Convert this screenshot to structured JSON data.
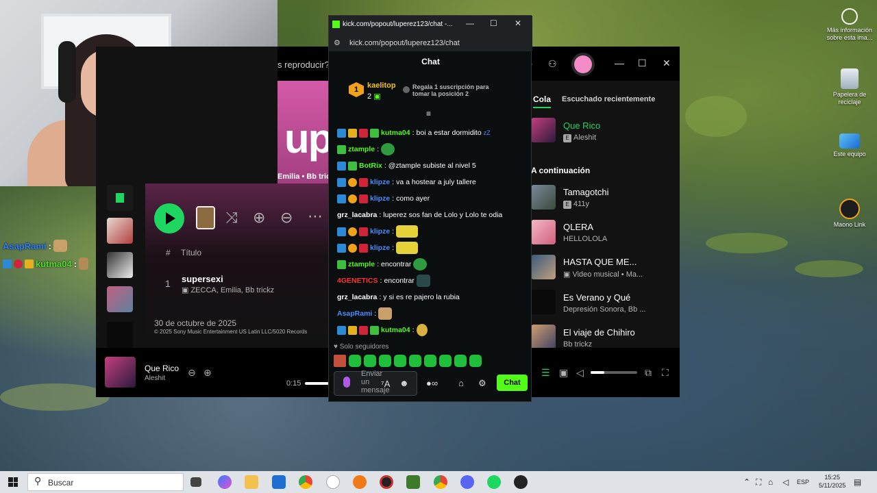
{
  "webcam_overlay_chat": [
    {
      "user": "AsapRami",
      "sep": ":"
    },
    {
      "user": "kutma04",
      "sep": ":"
    }
  ],
  "spotify": {
    "search_placeholder": "s reproducir?",
    "banner_text": "up",
    "banner_sub": "Emilia • Bb trick",
    "table_header": {
      "num": "#",
      "title": "Título"
    },
    "track": {
      "num": "1",
      "title": "supersexi",
      "artists": "ZECCA, Emilia, Bb trickz"
    },
    "release_date": "30 de octubre de 2025",
    "copyright": "© 2025 Sony Music Entertainment US Latin LLC/5020 Records",
    "now_playing": {
      "title": "Que Rico",
      "artist": "Aleshit",
      "time": "0:15"
    },
    "queue_tabs": [
      "Cola",
      "Escuchado recientemente"
    ],
    "current": {
      "title": "Que Rico",
      "artist": "Aleshit",
      "explicit": true
    },
    "next_label": "A continuación",
    "queue": [
      {
        "title": "Tamagotchi",
        "artist": "411y",
        "explicit": true
      },
      {
        "title": "QLERA",
        "artist": "HELLOLOLA",
        "explicit": false
      },
      {
        "title": "HASTA QUE ME...",
        "artist": "Video musical • Ma...",
        "explicit": false
      },
      {
        "title": "Es Verano y Qué",
        "artist": "Depresión Sonora, Bb ...",
        "explicit": false
      },
      {
        "title": "El viaje de Chihiro",
        "artist": "Bb trickz",
        "explicit": false
      }
    ],
    "volume_fraction": 0.3,
    "progress_fraction": 0.05
  },
  "kick": {
    "window_title": "kick.com/popout/luperez123/chat -...",
    "url": "kick.com/popout/luperez123/chat",
    "header": "Chat",
    "top_gifter": {
      "rank": "1",
      "name": "kaelitop",
      "count": "2"
    },
    "gift_prompt": "Regala 1 suscripción para tomar la posición 2",
    "messages": [
      {
        "user": "kutma04",
        "text": "boi a estar dormidito",
        "color": "green"
      },
      {
        "user": "ztample",
        "text": "",
        "color": "green"
      },
      {
        "user": "BotRix",
        "text": "@ztample subiste al nivel 5",
        "color": "green"
      },
      {
        "user": "klipze",
        "text": "va a hostear a july tallere",
        "color": "blue"
      },
      {
        "user": "klipze",
        "text": "como ayer",
        "color": "blue"
      },
      {
        "user": "grz_lacabra",
        "text": "luperez sos fan de Lolo y Lolo te odia",
        "color": "plain"
      },
      {
        "user": "klipze",
        "text": "",
        "color": "blue"
      },
      {
        "user": "klipze",
        "text": "",
        "color": "blue"
      },
      {
        "user": "ztample",
        "text": "encontrar",
        "color": "green"
      },
      {
        "user": "4GENETICS",
        "text": "encontrar",
        "color": "red"
      },
      {
        "user": "grz_lacabra",
        "text": "y si es re pajero la rubia",
        "color": "plain"
      },
      {
        "user": "AsapRami",
        "text": "",
        "color": "blue"
      },
      {
        "user": "kutma04",
        "text": "",
        "color": "green"
      }
    ],
    "follower_mode": "Solo seguidores",
    "input_placeholder": "Enviar un mensaje",
    "send_label": "Chat"
  },
  "desktop_icons": [
    {
      "label": "Más información sobre esta ima...",
      "icon": "info-icon"
    },
    {
      "label": "Papelera de reciclaje",
      "icon": "recycle-bin-icon"
    },
    {
      "label": "Este equipo",
      "icon": "computer-icon"
    },
    {
      "label": "Maono Link",
      "icon": "maono-icon"
    }
  ],
  "taskbar": {
    "search_label": "Buscar",
    "lang": "ESP",
    "time": "15:25",
    "date": "5/11/2025"
  }
}
